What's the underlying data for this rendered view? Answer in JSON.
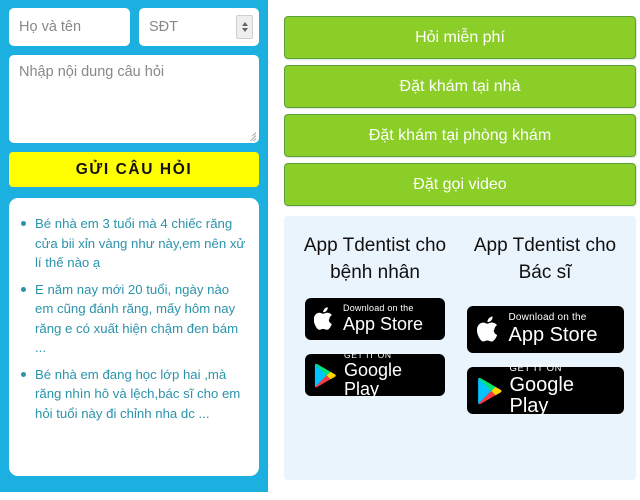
{
  "form": {
    "name_placeholder": "Họ và tên",
    "phone_placeholder": "SĐT",
    "question_placeholder": "Nhập nội dung câu hỏi",
    "submit_label": "GỬI CÂU HỎI",
    "spinner_icon": "stepper-arrows-icon",
    "resize_icon": "resize-grip-icon"
  },
  "questions": [
    "Bé nhà em 3 tuổi mà 4 chiếc răng cửa bii xỉn vàng như này,em nên xử lí thế nào ạ",
    "E năm nay mới 20 tuổi, ngày nào em cũng đánh răng, mấy hôm nay răng e có xuất hiện chậm đen bám ...",
    "Bé nhà em đang học lớp hai ,mà răng nhìn hô và lệch,bác sĩ cho em hỏi tuổi này đi chỉnh nha dc ..."
  ],
  "actions": [
    "Hỏi miễn phí",
    "Đặt khám tại nhà",
    "Đặt khám tại phòng khám",
    "Đặt gọi video"
  ],
  "apps": {
    "patient": {
      "title": "App Tdentist cho bệnh nhân",
      "appstore": {
        "small": "Download on the",
        "big": "App Store",
        "icon": "apple-logo-icon"
      },
      "googleplay": {
        "small": "GET IT ON",
        "big": "Google Play",
        "icon": "google-play-triangle-icon"
      }
    },
    "doctor": {
      "title": "App Tdentist cho Bác sĩ",
      "appstore": {
        "small": "Download on the",
        "big": "App Store",
        "icon": "apple-logo-icon"
      },
      "googleplay": {
        "small": "GET IT ON",
        "big": "Google Play",
        "icon": "google-play-triangle-icon"
      }
    }
  },
  "colors": {
    "cyan": "#1cb0e0",
    "green": "#8cce28",
    "green_border": "#5aa03a",
    "yellow": "#ffff00",
    "question_text": "#2b93ab",
    "app_panel_bg": "#eaf4fc",
    "badge_bg": "#000000"
  }
}
